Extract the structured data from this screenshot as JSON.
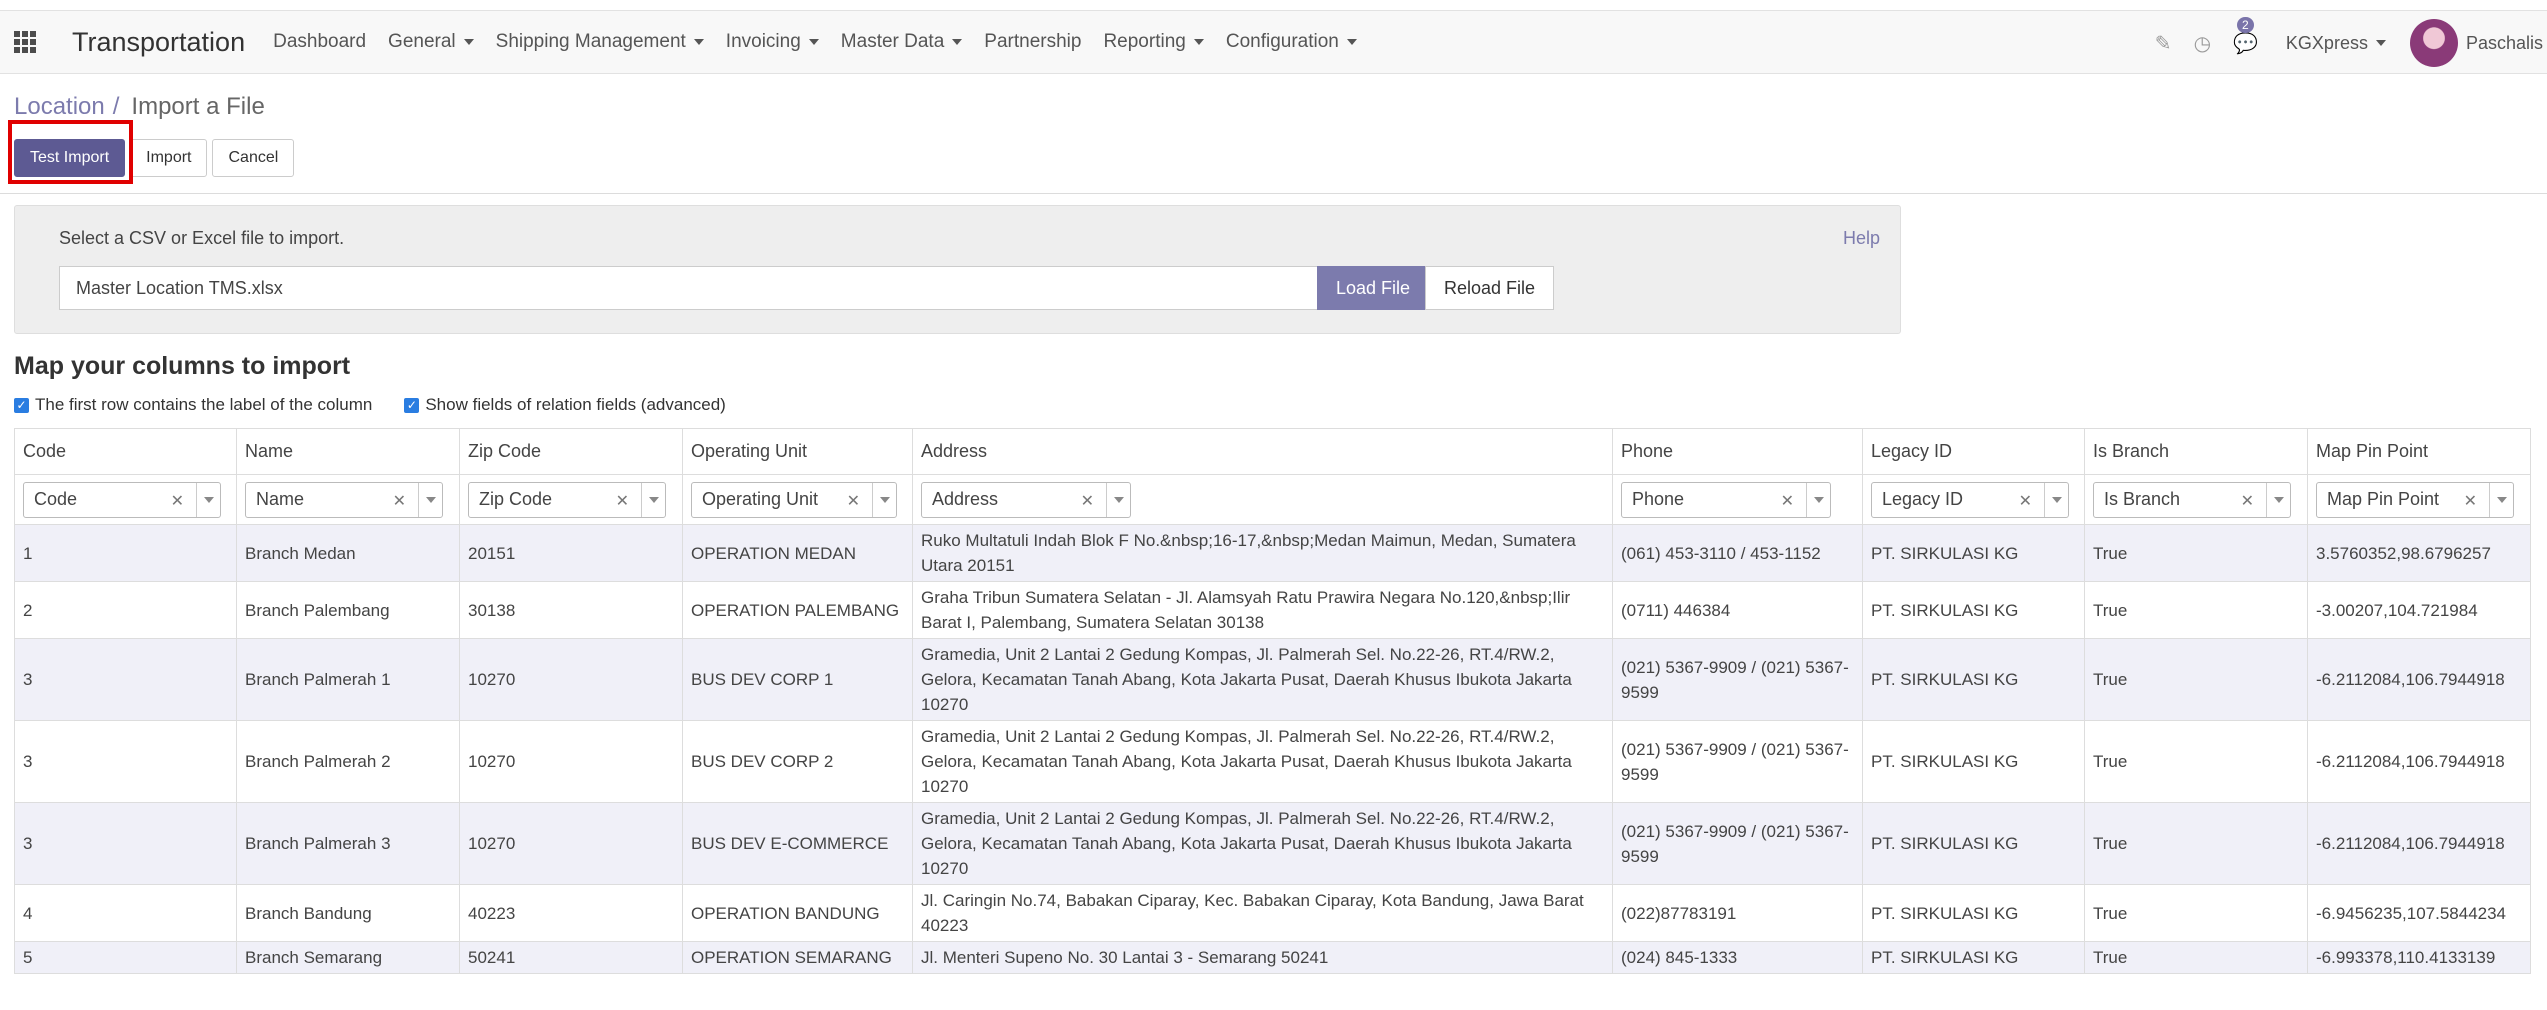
{
  "app": {
    "title": "Transportation"
  },
  "nav": {
    "menu": [
      {
        "label": "Dashboard",
        "dropdown": false
      },
      {
        "label": "General",
        "dropdown": true
      },
      {
        "label": "Shipping Management",
        "dropdown": true
      },
      {
        "label": "Invoicing",
        "dropdown": true
      },
      {
        "label": "Master Data",
        "dropdown": true
      },
      {
        "label": "Partnership",
        "dropdown": false
      },
      {
        "label": "Reporting",
        "dropdown": true
      },
      {
        "label": "Configuration",
        "dropdown": true
      }
    ],
    "chat_badge": "2",
    "company": "KGXpress",
    "user": "Paschalis"
  },
  "breadcrumb": {
    "parent": "Location",
    "separator": "/",
    "current": "Import a File"
  },
  "buttons": {
    "test_import": "Test Import",
    "import": "Import",
    "cancel": "Cancel"
  },
  "file": {
    "prompt": "Select a CSV or Excel file to import.",
    "help": "Help",
    "filename": "Master Location TMS.xlsx",
    "load": "Load File",
    "reload": "Reload File"
  },
  "mapping": {
    "title": "Map your columns to import",
    "opt_first_row": "The first row contains the label of the column",
    "opt_relation": "Show fields of relation fields (advanced)"
  },
  "table": {
    "headers": [
      "Code",
      "Name",
      "Zip Code",
      "Operating Unit",
      "Address",
      "Phone",
      "Legacy ID",
      "Is Branch",
      "Map Pin Point"
    ],
    "fields": [
      "Code",
      "Name",
      "Zip Code",
      "Operating Unit",
      "Address",
      "Phone",
      "Legacy ID",
      "Is Branch",
      "Map Pin Point"
    ],
    "rows": [
      [
        "1",
        "Branch Medan",
        "20151",
        "OPERATION MEDAN",
        "Ruko Multatuli Indah Blok F No.&nbsp;16-17,&nbsp;Medan Maimun, Medan, Sumatera Utara 20151",
        "(061) 453-3110 / 453-1152",
        "PT. SIRKULASI KG",
        "True",
        "3.5760352,98.6796257"
      ],
      [
        "2",
        "Branch Palembang",
        "30138",
        "OPERATION PALEMBANG",
        "Graha Tribun Sumatera Selatan - Jl. Alamsyah Ratu Prawira Negara No.120,&nbsp;Ilir Barat I, Palembang, Sumatera Selatan 30138",
        "(0711) 446384",
        "PT. SIRKULASI KG",
        "True",
        "-3.00207,104.721984"
      ],
      [
        "3",
        "Branch Palmerah 1",
        "10270",
        "BUS DEV CORP 1",
        "Gramedia, Unit 2 Lantai 2 Gedung Kompas, Jl. Palmerah Sel. No.22-26, RT.4/RW.2, Gelora, Kecamatan Tanah Abang, Kota Jakarta Pusat, Daerah Khusus Ibukota Jakarta 10270",
        "(021) 5367-9909 / (021) 5367-9599",
        "PT. SIRKULASI KG",
        "True",
        "-6.2112084,106.7944918"
      ],
      [
        "3",
        "Branch Palmerah 2",
        "10270",
        "BUS DEV CORP 2",
        "Gramedia, Unit 2 Lantai 2 Gedung Kompas, Jl. Palmerah Sel. No.22-26, RT.4/RW.2, Gelora, Kecamatan Tanah Abang, Kota Jakarta Pusat, Daerah Khusus Ibukota Jakarta 10270",
        "(021) 5367-9909 / (021) 5367-9599",
        "PT. SIRKULASI KG",
        "True",
        "-6.2112084,106.7944918"
      ],
      [
        "3",
        "Branch Palmerah 3",
        "10270",
        "BUS DEV E-COMMERCE",
        "Gramedia, Unit 2 Lantai 2 Gedung Kompas, Jl. Palmerah Sel. No.22-26, RT.4/RW.2, Gelora, Kecamatan Tanah Abang, Kota Jakarta Pusat, Daerah Khusus Ibukota Jakarta 10270",
        "(021) 5367-9909 / (021) 5367-9599",
        "PT. SIRKULASI KG",
        "True",
        "-6.2112084,106.7944918"
      ],
      [
        "4",
        "Branch Bandung",
        "40223",
        "OPERATION BANDUNG",
        "Jl. Caringin No.74, Babakan Ciparay, Kec. Babakan Ciparay, Kota Bandung, Jawa Barat 40223",
        "(022)87783191",
        "PT. SIRKULASI KG",
        "True",
        "-6.9456235,107.5844234"
      ],
      [
        "5",
        "Branch Semarang",
        "50241",
        "OPERATION SEMARANG",
        "Jl. Menteri Supeno No. 30 Lantai 3 - Semarang 50241",
        "(024) 845-1333",
        "PT. SIRKULASI KG",
        "True",
        "-6.993378,110.4133139"
      ]
    ]
  }
}
